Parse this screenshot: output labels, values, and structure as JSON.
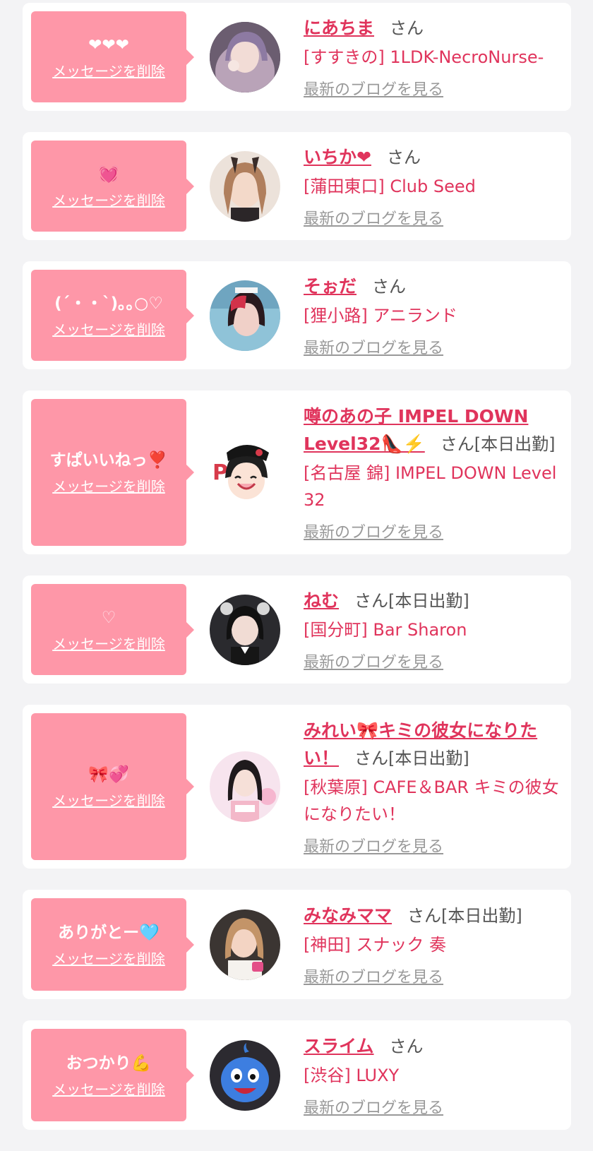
{
  "delete_label": "メッセージを削除",
  "blog_label": "最新のブログを見る",
  "san_label": "さん",
  "colors": {
    "accent_pink": "#fe97a8",
    "name_pink": "#e0345c",
    "card_bg": "#ffffff",
    "page_bg": "#f3f3f5"
  },
  "entries": [
    {
      "message": "❤❤❤",
      "name": "にあちま",
      "today": "",
      "store": "[すすきの] 1LDK-NecroNurse-"
    },
    {
      "message": "💓",
      "name": "いちか❤",
      "today": "",
      "store": "[蒲田東口] Club Seed"
    },
    {
      "message": "(´・・`)｡｡○♡",
      "name": "そぉだ",
      "today": "",
      "store": "[狸小路] アニランド"
    },
    {
      "message": "すぱいいねっ❣️",
      "name": "噂のあの子 IMPEL DOWN Level32👠⚡️",
      "today": "[本日出勤]",
      "store": "[名古屋 錦] IMPEL DOWN Level32"
    },
    {
      "message": "♡",
      "name": "ねむ",
      "today": "[本日出勤]",
      "store": "[国分町] Bar Sharon"
    },
    {
      "message": "🎀💞",
      "name": "みれい🎀キミの彼女になりたい！",
      "today": "[本日出勤]",
      "store": "[秋葉原] CAFE＆BAR キミの彼女になりたい！"
    },
    {
      "message": "ありがとー🩵",
      "name": "みなみママ",
      "today": "[本日出勤]",
      "store": "[神田] スナック 奏"
    },
    {
      "message": "おつかり💪",
      "name": "スライム",
      "today": "",
      "store": "[渋谷] LUXY"
    }
  ]
}
